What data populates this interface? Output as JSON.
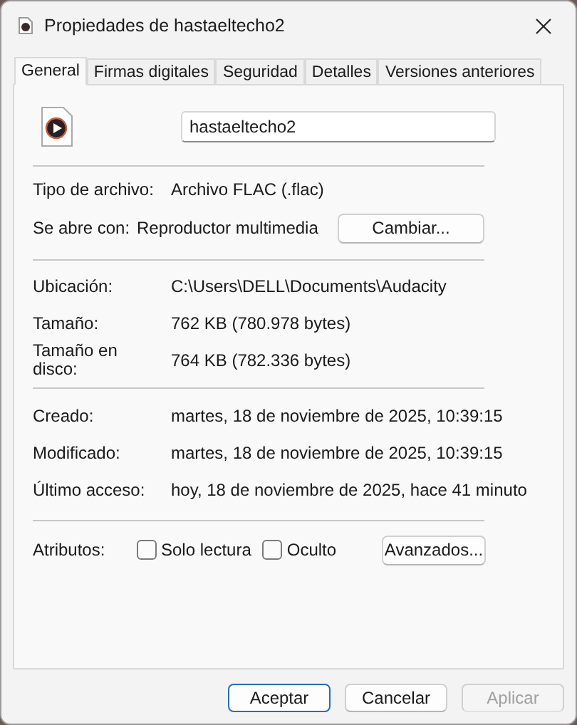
{
  "window": {
    "title": "Propiedades de hastaeltecho2"
  },
  "tabs": [
    {
      "label": "General",
      "selected": true
    },
    {
      "label": "Firmas digitales",
      "selected": false
    },
    {
      "label": "Seguridad",
      "selected": false
    },
    {
      "label": "Detalles",
      "selected": false
    },
    {
      "label": "Versiones anteriores",
      "selected": false
    }
  ],
  "file_name": "hastaeltecho2",
  "type_row": {
    "label": "Tipo de archivo:",
    "value": "Archivo FLAC (.flac)"
  },
  "opens_with": {
    "label": "Se abre con:",
    "value": "Reproductor multimedia",
    "button": "Cambiar..."
  },
  "location_rows": [
    {
      "label": "Ubicación:",
      "value": "C:\\Users\\DELL\\Documents\\Audacity"
    },
    {
      "label": "Tamaño:",
      "value": "762 KB (780.978 bytes)"
    },
    {
      "label": "Tamaño en disco:",
      "value": "764 KB (782.336 bytes)"
    }
  ],
  "date_rows": [
    {
      "label": "Creado:",
      "value": "martes, 18 de noviembre de 2025, 10:39:15"
    },
    {
      "label": "Modificado:",
      "value": "martes, 18 de noviembre de 2025, 10:39:15"
    },
    {
      "label": "Último acceso:",
      "value": "hoy, 18 de noviembre de 2025, hace 41 minuto"
    }
  ],
  "attributes": {
    "label": "Atributos:",
    "options": [
      {
        "label": "Solo lectura",
        "checked": false
      },
      {
        "label": "Oculto",
        "checked": false
      }
    ],
    "button": "Avanzados..."
  },
  "buttons": [
    {
      "label": "Aceptar",
      "primary": true,
      "disabled": false
    },
    {
      "label": "Cancelar",
      "primary": false,
      "disabled": false
    },
    {
      "label": "Aplicar",
      "primary": false,
      "disabled": true
    }
  ]
}
